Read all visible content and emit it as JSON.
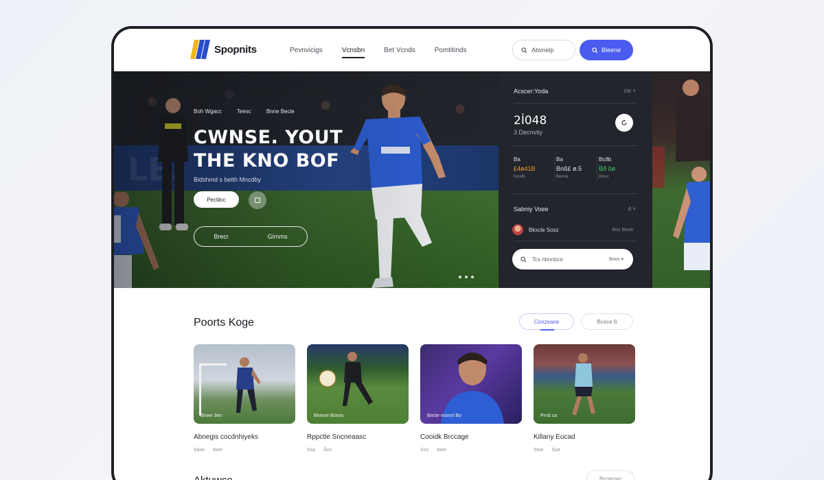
{
  "nav": {
    "brand": "Spopnits",
    "links": [
      "Pevnvicigs",
      "Vcnsbn",
      "Bet Vcnds",
      "Pomtitinds"
    ],
    "search_label": "Abvnelp",
    "cta_label": "Bleene"
  },
  "hero": {
    "tabs": [
      "Boh Wgacc",
      "Teesc",
      "Bnne Becie"
    ],
    "title_line1": "CWNSE. YOUT",
    "title_line2": "THE KNO BOF",
    "subtitle": "Bidshmd s beith Mncdby",
    "primary_button": "Pectilcc",
    "outline_left": "Brecr",
    "outline_right": "Girnms"
  },
  "panel": {
    "header": "Acscer:Yoda",
    "header_action": "cte ×",
    "big_value": "2İ048",
    "big_sub": "3 Decnvtiy",
    "stats": [
      {
        "label": "Ba",
        "value": "£4ø41B",
        "color": "#f0a030",
        "sub": "İooxtb"
      },
      {
        "label": "Ba",
        "value": "Bnß£ ø.5",
        "color": "#e6e7ea",
        "sub": "Benne"
      },
      {
        "label": "Bcðb",
        "value": "Bð öø",
        "color": "#3ccf6a",
        "sub": "Dnvu"
      }
    ],
    "section": "Sabniy Voee",
    "section_action": "d ×",
    "item_name": "Bkxcle Sosz",
    "item_meta": "Boc Booe",
    "search_placeholder": "Tcs nbnnbce",
    "search_right": "Bovs ▾"
  },
  "content": {
    "section_title": "Poorts Koge",
    "pill_active": "Conzeane",
    "pill_other": "Bcece ß",
    "cards": [
      {
        "caption": "Bnwe 3en",
        "title": "Abnegis cocdnhiyeks",
        "meta": [
          "Saxe",
          "Woe"
        ]
      },
      {
        "caption": "Bhmne Bomis",
        "title": "Rppctle Sncneaasc",
        "meta": [
          "Ssa",
          "Åce"
        ]
      },
      {
        "caption": "Bncte monnt Bo",
        "title": "Cooidk Brccage",
        "meta": [
          "Sco",
          "Woe"
        ]
      },
      {
        "caption": "Prnd ca",
        "title": "Killany Eucad",
        "meta": [
          "Stoe",
          "Soe"
        ]
      }
    ],
    "bottom_title": "Aktuwce",
    "bottom_pill": "Brcanser"
  }
}
